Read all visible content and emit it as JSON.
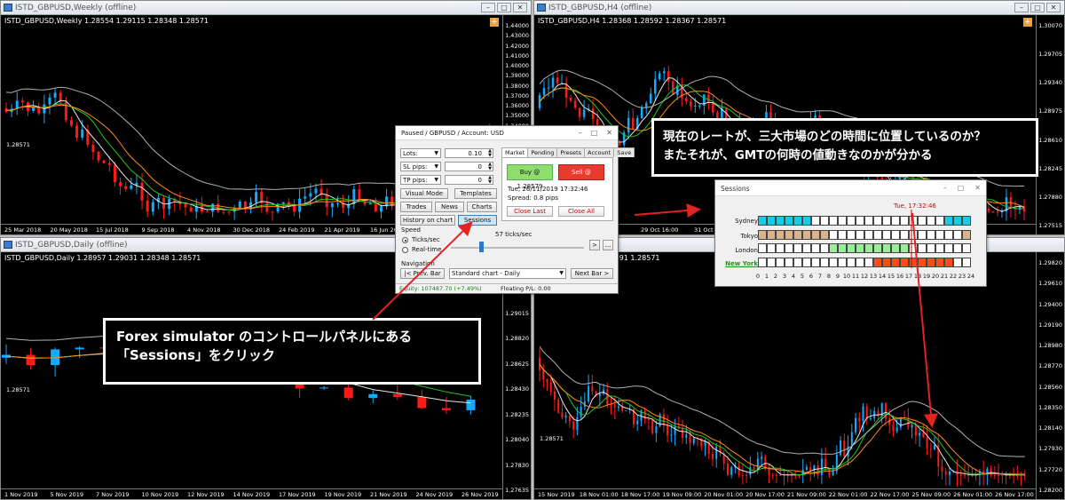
{
  "charts": {
    "weekly": {
      "title": "ISTD_GBPUSD,Weekly (offline)",
      "symbol_line": "ISTD_GBPUSD,Weekly  1.28554 1.29115 1.28348 1.28571",
      "current_price": "1.28571",
      "prices": [
        "1.44000",
        "1.43000",
        "1.42000",
        "1.41000",
        "1.40000",
        "1.39000",
        "1.38000",
        "1.37000",
        "1.36000",
        "1.35000",
        "1.34000",
        "1.33000",
        "1.32000",
        "1.31000",
        "1.30000",
        "1.29000",
        "1.28000",
        "1.27000",
        "1.26000",
        "1.25000",
        "1.24000"
      ],
      "dates": [
        "25 Mar 2018",
        "20 May 2018",
        "15 Jul 2018",
        "9 Sep 2018",
        "4 Nov 2018",
        "30 Dec 2018",
        "24 Feb 2019",
        "21 Apr 2019",
        "16 Jun 2019",
        "11 Aug 2019",
        "6 Oct 2019"
      ]
    },
    "h4": {
      "title": "ISTD_GBPUSD,H4 (offline)",
      "symbol_line": "ISTD_GBPUSD,H4  1.28368 1.28592 1.28367 1.28571",
      "current_price": "1.28571",
      "prices": [
        "1.30070",
        "1.29705",
        "1.29340",
        "1.28975",
        "1.28610",
        "1.28245",
        "1.27880",
        "1.27515"
      ],
      "dates": [
        "29 Oct 16:00",
        "31 Oct 16:00"
      ]
    },
    "daily": {
      "title": "ISTD_GBPUSD,Daily (offline)",
      "symbol_line": "ISTD_GBPUSD,Daily  1.28957 1.29031 1.28348 1.28571",
      "current_price": "1.28571",
      "prices": [
        "1.29405",
        "1.29210",
        "1.29015",
        "1.28820",
        "1.28625",
        "1.28430",
        "1.28235",
        "1.28040",
        "1.27830",
        "1.27635"
      ],
      "dates": [
        "1 Nov 2019",
        "5 Nov 2019",
        "7 Nov 2019",
        "10 Nov 2019",
        "12 Nov 2019",
        "14 Nov 2019",
        "17 Nov 2019",
        "19 Nov 2019",
        "21 Nov 2019",
        "24 Nov 2019",
        "26 Nov 2019"
      ]
    },
    "m15": {
      "title": "",
      "symbol_line": "ISTD_GBPUSD,...  1.28491 1.28571",
      "current_price": "1.28571",
      "prices": [
        "1.29820",
        "1.29610",
        "1.29400",
        "1.29190",
        "1.28980",
        "1.28770",
        "1.28560",
        "1.28350",
        "1.28140",
        "1.27930",
        "1.27720",
        "1.28200"
      ],
      "dates": [
        "15 Nov 2019",
        "18 Nov 01:00",
        "18 Nov 17:00",
        "19 Nov 09:00",
        "20 Nov 01:00",
        "20 Nov 17:00",
        "21 Nov 09:00",
        "22 Nov 01:00",
        "22 Nov 17:00",
        "25 Nov 09:00",
        "26 Nov 01:00",
        "26 Nov 17:00"
      ]
    }
  },
  "panel": {
    "title": "Paused / GBPUSD / Account: USD",
    "lots_label": "Lots:",
    "lots_value": "0.10",
    "sl_label": "SL pips:",
    "sl_value": "0",
    "tp_label": "TP pips:",
    "tp_value": "0",
    "visual_mode": "Visual Mode",
    "templates": "Templates",
    "trades": "Trades",
    "news": "News",
    "charts": "Charts",
    "history": "History on chart",
    "sessions": "Sessions",
    "tabs": [
      "Market",
      "Pending",
      "Presets",
      "Account",
      "Save"
    ],
    "buy": "Buy @ 1.28579",
    "sell": "Sell @ 1.28571",
    "datetime": "Tue, 26/11/2019  17:32:46",
    "spread": "Spread: 0.8 pips",
    "close_last": "Close Last",
    "close_all": "Close All",
    "speed_label": "Speed",
    "ticks_label": "Ticks/sec",
    "realtime_label": "Real-time",
    "ticks_value": "57 ticks/sec",
    "navigation_label": "Navigation",
    "prev_bar": "|< Prev. Bar",
    "chart_select": "Standard chart - Daily",
    "next_bar": "Next Bar >",
    "equity": "Equity:  107487.70  (+7.49%)",
    "floating": "Floating P/L:  0.00"
  },
  "sessions_window": {
    "title": "Sessions",
    "time": "Tue, 17:32:46",
    "markets": [
      "Sydney",
      "Tokyo",
      "London",
      "New York"
    ],
    "hours": [
      "0",
      "1",
      "2",
      "3",
      "4",
      "5",
      "6",
      "7",
      "8",
      "9",
      "10",
      "11",
      "12",
      "13",
      "14",
      "15",
      "16",
      "17",
      "18",
      "19",
      "20",
      "21",
      "22",
      "23",
      "24"
    ],
    "colors": {
      "sydney": "#1cc9e6",
      "tokyo": "#d8b48c",
      "london": "#99ef99",
      "newyork": "#ff4a1a"
    }
  },
  "annotations": {
    "left_line1": "Forex simulator のコントロールパネルにある",
    "left_line2": "「Sessions」をクリック",
    "right_line1": "現在のレートが、三大市場のどの時間に位置しているのか？",
    "right_line2": "またそれが、GMTの何時の値動きなのかが分かる"
  }
}
